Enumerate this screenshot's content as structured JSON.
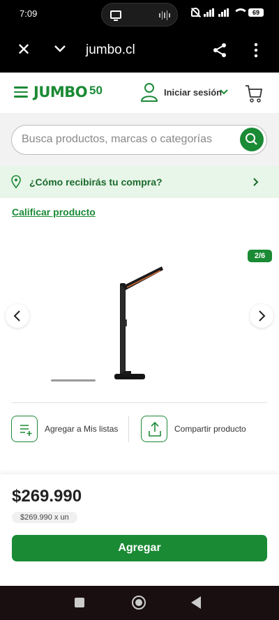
{
  "status_bar": {
    "time": "7:09",
    "battery": "69"
  },
  "browser": {
    "url": "jumbo.cl"
  },
  "header": {
    "logo_text": "JUMBO",
    "logo_badge": "50",
    "login_label": "Iniciar sesión"
  },
  "search": {
    "placeholder": "Busca productos, marcas o categorías"
  },
  "delivery": {
    "label": "¿Cómo recibirás tu compra?"
  },
  "product": {
    "rate_label": "Calificar producto",
    "gallery_counter": "2/6",
    "price": "$269.990",
    "unit_price": "$269.990 x un"
  },
  "actions": {
    "add_to_list": "Agregar a Mis listas",
    "share": "Compartir producto"
  },
  "cta": {
    "add_label": "Agregar"
  },
  "colors": {
    "brand_green": "#1a8a35",
    "delivery_bg": "#e8f5e9"
  }
}
